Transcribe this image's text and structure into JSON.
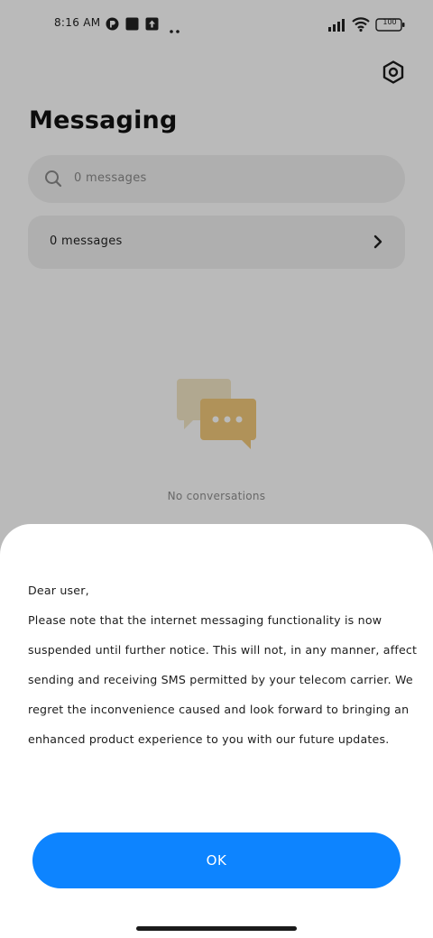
{
  "status_bar": {
    "time": "8:16 AM",
    "left_icons": [
      "app-notification-icon",
      "square-notification-icon",
      "upload-icon",
      "more-dots-icon"
    ],
    "battery": "100"
  },
  "header": {
    "title": "Messaging",
    "settings_icon": "settings-icon"
  },
  "search": {
    "placeholder": "0 messages"
  },
  "messages_card": {
    "label": "0 messages"
  },
  "empty_state": {
    "text": "No conversations",
    "illustration": "chat-bubbles-icon"
  },
  "dialog": {
    "greeting": "Dear user,",
    "message": "Please note that the internet messaging functionality is now suspended until further notice. This will not, in any manner, affect sending and receiving SMS permitted by your telecom carrier. We regret the inconvenience caused and look forward to bringing an enhanced product experience to you with our future updates.",
    "ok_label": "OK"
  },
  "colors": {
    "accent": "#0d84ff",
    "scrim": "rgba(0,0,0,0.27)",
    "illustration": "#f2c97a"
  }
}
